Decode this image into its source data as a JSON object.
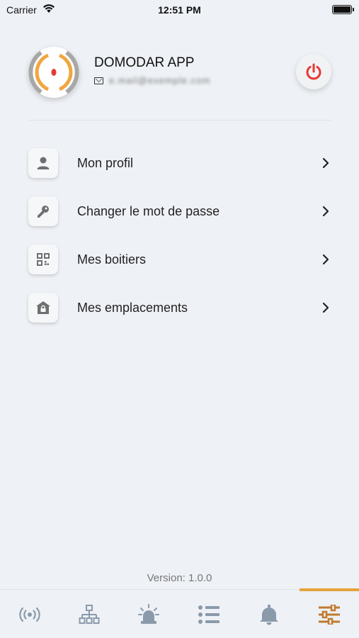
{
  "status_bar": {
    "carrier": "Carrier",
    "time": "12:51 PM",
    "wifi_icon": "wifi-icon",
    "battery_icon": "battery-icon"
  },
  "profile": {
    "app_name": "DOMODAR APP",
    "email": "e.mail@exemple.com",
    "avatar_icon": "domodar-logo",
    "logout_icon": "power-icon",
    "colors": {
      "logo_orange": "#f0a640",
      "logo_gray": "#a7a7a7",
      "logo_red": "#e53935",
      "power_red": "#e53935"
    }
  },
  "menu": {
    "items": [
      {
        "label": "Mon profil",
        "icon": "user-icon"
      },
      {
        "label": "Changer le mot de passe",
        "icon": "key-icon"
      },
      {
        "label": "Mes boitiers",
        "icon": "qr-code-icon"
      },
      {
        "label": "Mes emplacements",
        "icon": "home-lock-icon"
      }
    ]
  },
  "version": "Version: 1.0.0",
  "tab_bar": {
    "tabs": [
      {
        "icon": "broadcast-icon",
        "active": false
      },
      {
        "icon": "network-icon",
        "active": false
      },
      {
        "icon": "alarm-siren-icon",
        "active": false
      },
      {
        "icon": "list-icon",
        "active": false
      },
      {
        "icon": "bell-icon",
        "active": false
      },
      {
        "icon": "sliders-icon",
        "active": true
      }
    ],
    "colors": {
      "active": "#c07a2e",
      "inactive": "#8a9aab",
      "indicator": "#e6a23c"
    }
  }
}
